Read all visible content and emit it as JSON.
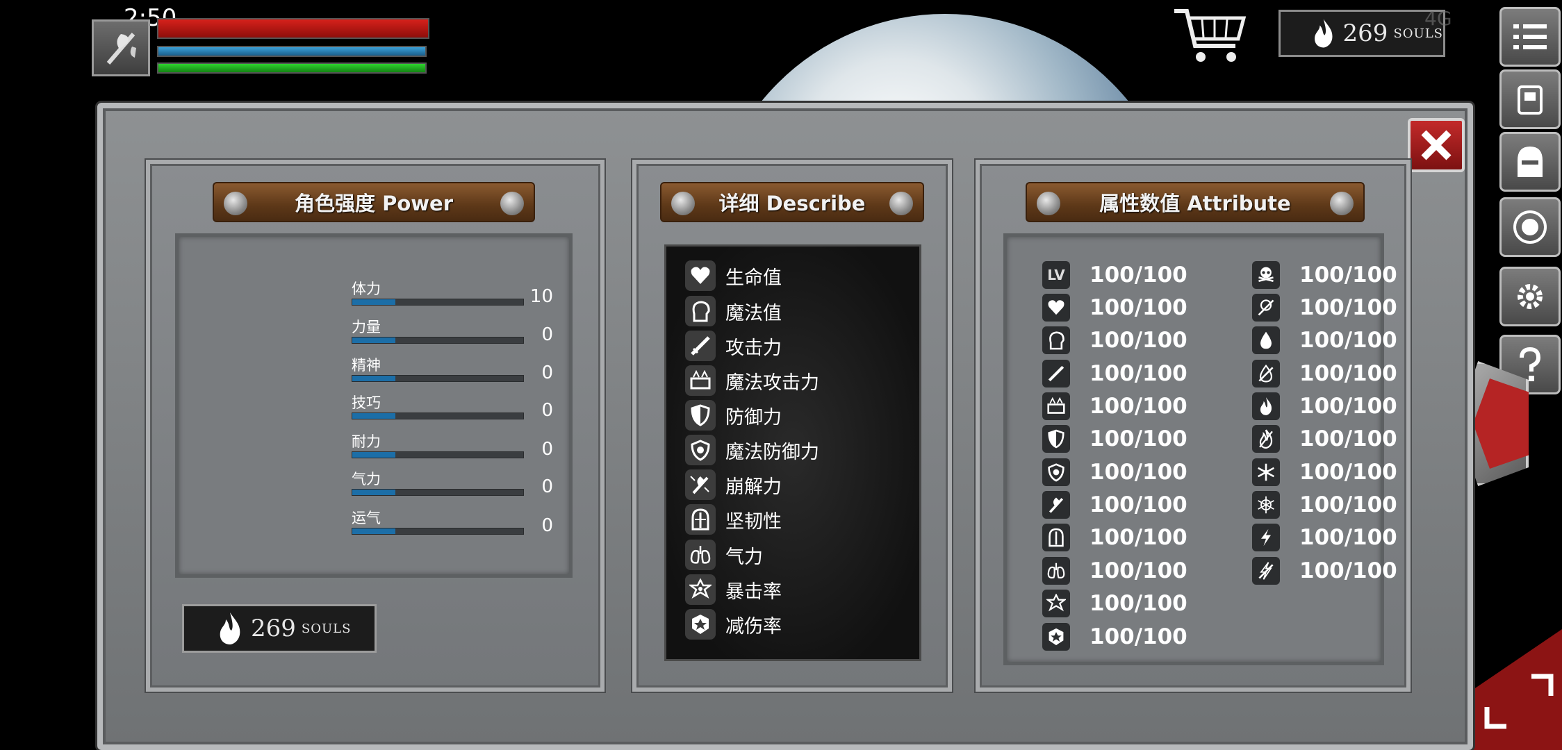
{
  "status_bar": {
    "time": "2:50",
    "signal": "4G"
  },
  "hud": {
    "hp_fill": 1.0,
    "mp_fill": 1.0,
    "stamina_fill": 1.0
  },
  "souls": {
    "count": "269",
    "unit": "SOULS"
  },
  "power_panel": {
    "title": "角色强度 Power",
    "stats": [
      {
        "label": "体力",
        "value": "10",
        "fill": 0.25
      },
      {
        "label": "力量",
        "value": "0",
        "fill": 0.25
      },
      {
        "label": "精神",
        "value": "0",
        "fill": 0.25
      },
      {
        "label": "技巧",
        "value": "0",
        "fill": 0.25
      },
      {
        "label": "耐力",
        "value": "0",
        "fill": 0.25
      },
      {
        "label": "气力",
        "value": "0",
        "fill": 0.25
      },
      {
        "label": "运气",
        "value": "0",
        "fill": 0.25
      }
    ]
  },
  "describe_panel": {
    "title": "详细 Describe",
    "items": [
      {
        "label": "生命值",
        "icon": "heart-icon"
      },
      {
        "label": "魔法值",
        "icon": "head-icon"
      },
      {
        "label": "攻击力",
        "icon": "sword-icon"
      },
      {
        "label": "魔法攻击力",
        "icon": "spellbook-icon"
      },
      {
        "label": "防御力",
        "icon": "shield-icon"
      },
      {
        "label": "魔法防御力",
        "icon": "magic-shield-icon"
      },
      {
        "label": "崩解力",
        "icon": "broken-axe-icon"
      },
      {
        "label": "坚韧性",
        "icon": "helmet-icon"
      },
      {
        "label": "气力",
        "icon": "lungs-icon"
      },
      {
        "label": "暴击率",
        "icon": "critical-star-icon"
      },
      {
        "label": "减伤率",
        "icon": "damage-reduction-icon"
      }
    ]
  },
  "attribute_panel": {
    "title": "属性数值 Attribute",
    "level_label": "LV",
    "left_column": [
      {
        "icon": "level-icon",
        "value": "100/100"
      },
      {
        "icon": "heart-icon",
        "value": "100/100"
      },
      {
        "icon": "head-icon",
        "value": "100/100"
      },
      {
        "icon": "sword-icon",
        "value": "100/100"
      },
      {
        "icon": "spellbook-icon",
        "value": "100/100"
      },
      {
        "icon": "shield-icon",
        "value": "100/100"
      },
      {
        "icon": "magic-shield-icon",
        "value": "100/100"
      },
      {
        "icon": "broken-axe-icon",
        "value": "100/100"
      },
      {
        "icon": "helmet-icon",
        "value": "100/100"
      },
      {
        "icon": "lungs-icon",
        "value": "100/100"
      },
      {
        "icon": "critical-star-icon",
        "value": "100/100"
      },
      {
        "icon": "damage-reduction-icon",
        "value": "100/100"
      }
    ],
    "right_column": [
      {
        "icon": "skull-icon",
        "value": "100/100"
      },
      {
        "icon": "poison-resist-icon",
        "value": "100/100"
      },
      {
        "icon": "blood-drop-icon",
        "value": "100/100"
      },
      {
        "icon": "bleed-resist-icon",
        "value": "100/100"
      },
      {
        "icon": "fire-icon",
        "value": "100/100"
      },
      {
        "icon": "fire-resist-icon",
        "value": "100/100"
      },
      {
        "icon": "snowflake-icon",
        "value": "100/100"
      },
      {
        "icon": "frost-resist-icon",
        "value": "100/100"
      },
      {
        "icon": "lightning-icon",
        "value": "100/100"
      },
      {
        "icon": "lightning-resist-icon",
        "value": "100/100"
      }
    ]
  },
  "side_menu": [
    "menu-icon",
    "inventory-icon",
    "equipment-helmet-icon",
    "skill-emblem-icon",
    "settings-gear-icon",
    "help-icon"
  ],
  "colors": {
    "hp": "#d6211b",
    "mp": "#3aa0d8",
    "stamina": "#2fd32f",
    "stat_fill": "#1c6ea7",
    "close_red": "#c32a2a"
  }
}
